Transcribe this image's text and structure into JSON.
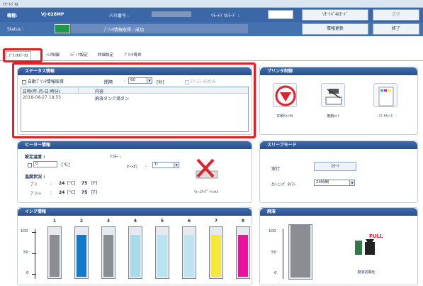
{
  "window_title": "ﾘﾓｰﾄﾊﾟﾈﾙ",
  "header": {
    "model_label": "機種:",
    "model_value": "VJ-628MP",
    "serial_label": "ｼﾘｱﾙ番号 :",
    "serial_value": "",
    "remote_mode_label": "ﾘﾓｰﾄﾊﾟﾈﾙﾓｰﾄﾞ :",
    "remote_mode_value": "",
    "status_label": "Status :",
    "status_text": "ﾌﾟﾘﾝﾀ情報取得 : 成功",
    "status_color": "#1a9a4a",
    "btn_remote_mode": "ﾘﾓｰﾄﾊﾟﾈﾙﾓｰﾄﾞ",
    "btn_send": "送信",
    "btn_update": "情報更新",
    "btn_exit": "終了"
  },
  "tabs": [
    "ﾌﾟﾘﾝﾀｽﾃｰﾀｽ",
    "ｲﾝｸ制御",
    "ﾒﾃﾞｨｱ設定",
    "詳細設定",
    "ﾌﾟﾘﾝﾀ寿命"
  ],
  "status_panel": {
    "title": "ステータス情報",
    "auto_label": "自動ﾌﾟﾘﾝﾀ情報取得",
    "interval_label": "間隔",
    "interval_value": "60",
    "interval_unit": "[秒]",
    "errors_only_label": "ｴﾗｰｽﾃｰﾀｽのみ",
    "col_date": "日時(年-月-日-時分)",
    "col_content": "内容",
    "rows": [
      {
        "date": "2018-08-27 18:55",
        "content": "廃液タンク満タン"
      }
    ]
  },
  "printer_panel": {
    "title": "プリンタ制御",
    "items": [
      "印刷ｷｬﾝｾﾙ",
      "用紙ｶｯﾄ",
      "ﾉｽﾞﾙﾁｪｯｸ"
    ]
  },
  "heater_panel": {
    "title": "ヒーター情報",
    "set_temp_label": "設定温度 :",
    "set_temp_value": "0",
    "unit_c": "[℃]",
    "after_label": "ｱﾌﾀｰ :",
    "auto_label": "ｵｰﾄｵﾌ",
    "auto_value": "ｵﾝ",
    "temp_status_label": "温度状況 :",
    "pre_label": "ﾌﾟﾘ",
    "pre_c": "24",
    "pre_f": "75",
    "print_label": "ﾌﾟﾘﾝﾄ",
    "print_c": "24",
    "print_f": "75",
    "unit_c2": "[℃]",
    "unit_f": "[F]",
    "warmup_cancel": "ｳｫｰﾑｱｯﾌﾟ ｷｬﾝｾﾙ"
  },
  "sleep_panel": {
    "title": "スリープモード",
    "exec_label": "実行",
    "start_button": "ｽﾀｰﾄ",
    "cleaning_timer_label": "ｸﾘｰﾆﾝｸﾞ ﾀｲﾏｰ",
    "timer_value": "24時間"
  },
  "ink_panel": {
    "title": "インク情報",
    "y_ticks": [
      "100",
      "50",
      "0"
    ],
    "slots": [
      {
        "num": "1",
        "level": 85,
        "color": "#8a8d92"
      },
      {
        "num": "2",
        "level": 85,
        "color": "#1479c8"
      },
      {
        "num": "3",
        "level": 85,
        "color": "#8a8d92"
      },
      {
        "num": "4",
        "level": 85,
        "color": "#a7dbe8"
      },
      {
        "num": "5",
        "level": 85,
        "color": "#b8e3f0"
      },
      {
        "num": "6",
        "level": 85,
        "color": "#bfe4f1"
      },
      {
        "num": "7",
        "level": 85,
        "color": "#f6e836"
      },
      {
        "num": "8",
        "level": 85,
        "color": "#e8149c"
      }
    ]
  },
  "waste_panel": {
    "title": "廃液",
    "y_ticks": [
      "100",
      "50",
      "0"
    ],
    "level": 100,
    "fill_label": "FULL",
    "init_button": "廃液初期化"
  }
}
